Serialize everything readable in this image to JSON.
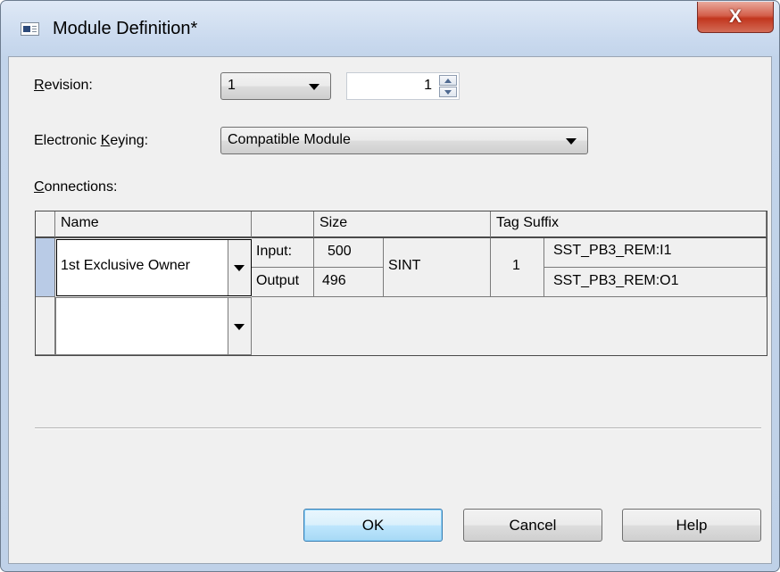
{
  "window": {
    "title": "Module Definition*",
    "close_label": "X"
  },
  "form": {
    "revision_label": "Revision:",
    "revision_major": "1",
    "revision_minor": "1",
    "keying_label": "Electronic Keying:",
    "keying_value": "Compatible Module",
    "connections_label": "Connections:"
  },
  "grid": {
    "headers": {
      "name": "Name",
      "size": "Size",
      "tag_suffix": "Tag Suffix"
    },
    "rows": [
      {
        "name": "1st Exclusive Owner",
        "input_label": "Input:",
        "input_size": "500",
        "output_label": "Output",
        "output_size": "496",
        "type": "SINT",
        "count": "1",
        "input_tag": "SST_PB3_REM:I1",
        "output_tag": "SST_PB3_REM:O1"
      },
      {
        "name": ""
      }
    ]
  },
  "buttons": {
    "ok": "OK",
    "cancel": "Cancel",
    "help": "Help"
  }
}
